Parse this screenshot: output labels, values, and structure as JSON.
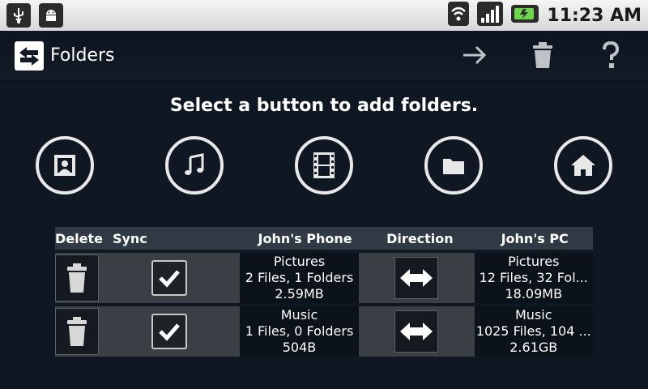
{
  "statusbar": {
    "time": "11:23 AM"
  },
  "app": {
    "title": "Folders"
  },
  "prompt": "Select a button to add folders.",
  "table": {
    "headers": [
      "Delete",
      "Sync",
      "John's Phone",
      "Direction",
      "John's PC"
    ],
    "rows": [
      {
        "phone": {
          "name": "Pictures",
          "counts": "2 Files, 1 Folders",
          "size": "2.59MB"
        },
        "pc": {
          "name": "Pictures",
          "counts": "12 Files, 32 Fol...",
          "size": "18.09MB"
        }
      },
      {
        "phone": {
          "name": "Music",
          "counts": "1 Files, 0 Folders",
          "size": "504B"
        },
        "pc": {
          "name": "Music",
          "counts": "1025 Files, 104 ...",
          "size": "2.61GB"
        }
      }
    ]
  }
}
